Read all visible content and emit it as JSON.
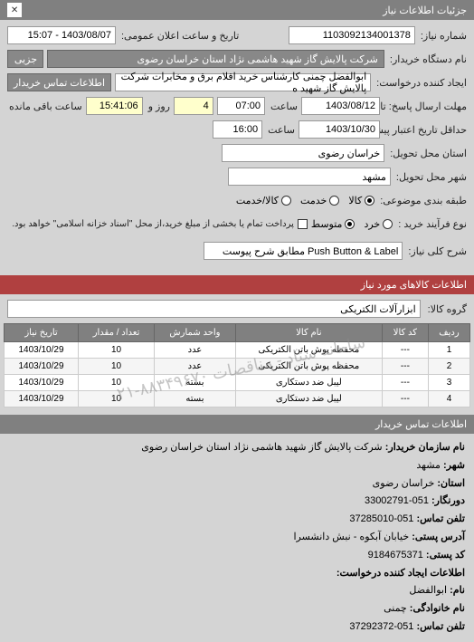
{
  "header": {
    "title": "جزئیات اطلاعات نیاز",
    "close": "✕"
  },
  "form": {
    "req_no_label": "شماره نیاز:",
    "req_no": "1103092134001378",
    "announce_label": "تاریخ و ساعت اعلان عمومی:",
    "announce": "1403/08/07 - 15:07",
    "buyer_org_label": "نام دستگاه خریدار:",
    "buyer_org": "شرکت پالایش گاز شهید هاشمی نژاد   استان خراسان رضوی",
    "partial_label": "جزیی",
    "requester_label": "ایجاد کننده درخواست:",
    "requester": "ابوالفضل چمنی کارشناس خرید اقلام برق و مخابرات شرکت پالایش گاز شهید ه",
    "buyer_contact_link": "اطلاعات تماس خریدار",
    "deadline_from_label": "مهلت ارسال پاسخ: تا تاریخ:",
    "deadline_date": "1403/08/12",
    "deadline_time_label": "ساعت",
    "deadline_time": "07:00",
    "days_label": "روز و",
    "days": "4",
    "remain_label": "ساعت باقی مانده",
    "remain": "15:41:06",
    "validity_label": "حداقل تاریخ اعتبار پیشنهاد: تا تاریخ:",
    "validity_date": "1403/10/30",
    "validity_time_label": "ساعت",
    "validity_time": "16:00",
    "province_label": "استان محل تحویل:",
    "province": "خراسان رضوی",
    "city_label": "شهر محل تحویل:",
    "city": "مشهد",
    "priority_label": "طبقه بندی موضوعی:",
    "priority_options": {
      "low": "کالا",
      "mid": "خدمت",
      "high": "کالا/خدمت"
    },
    "buy_method_label": "نوع فرآیند خرید :",
    "buy_method_options": {
      "low": "خرد",
      "mid": "متوسط"
    },
    "buy_method_note": "پرداخت تمام یا بخشی از مبلغ خرید،از محل \"اسناد خزانه اسلامی\" خواهد بود.",
    "desc_label": "شرح کلی نیاز:",
    "desc": "Push Button & Label مطابق شرح پیوست"
  },
  "section_items_title": "اطلاعات کالاهای مورد نیاز",
  "group_label": "گروه کالا:",
  "group_value": "ابزارآلات الکتریکی",
  "table": {
    "headers": [
      "ردیف",
      "کد کالا",
      "نام کالا",
      "واحد شمارش",
      "تعداد / مقدار",
      "تاریخ نیاز"
    ],
    "rows": [
      [
        "1",
        "---",
        "محفظه پوش باتن الکتریکی",
        "عدد",
        "10",
        "1403/10/29"
      ],
      [
        "2",
        "---",
        "محفظه پوش باتن الکتریکی",
        "عدد",
        "10",
        "1403/10/29"
      ],
      [
        "3",
        "---",
        "لیبل ضد دستکاری",
        "بسته",
        "10",
        "1403/10/29"
      ],
      [
        "4",
        "---",
        "لیبل ضد دستکاری",
        "بسته",
        "10",
        "1403/10/29"
      ]
    ]
  },
  "watermark": "سامانه ستاد - مناقصات ۸۸۳۴۹۶۷۰-۰۲۱",
  "footer_title": "اطلاعات تماس خریدار",
  "contact": {
    "org_name_label": "نام سازمان خریدار:",
    "org_name": "شرکت پالایش گاز شهید هاشمی نژاد استان خراسان رضوی",
    "city_label": "شهر:",
    "city": "مشهد",
    "province_label": "استان:",
    "province": "خراسان رضوی",
    "fax_label": "دورنگار:",
    "fax": "051-33002791",
    "phone_label": "تلفن تماس:",
    "phone": "051-37285010",
    "address_label": "آدرس پستی:",
    "address": "خیابان آبکوه - نبش دانشسرا",
    "postal_label": "کد پستی:",
    "postal": "9184675371",
    "requester_title": "اطلاعات ایجاد کننده درخواست:",
    "name_label": "نام:",
    "name": "ابوالفضل",
    "lname_label": "نام خانوادگی:",
    "lname": "چمنی",
    "rphone_label": "تلفن تماس:",
    "rphone": "051-37292372"
  }
}
